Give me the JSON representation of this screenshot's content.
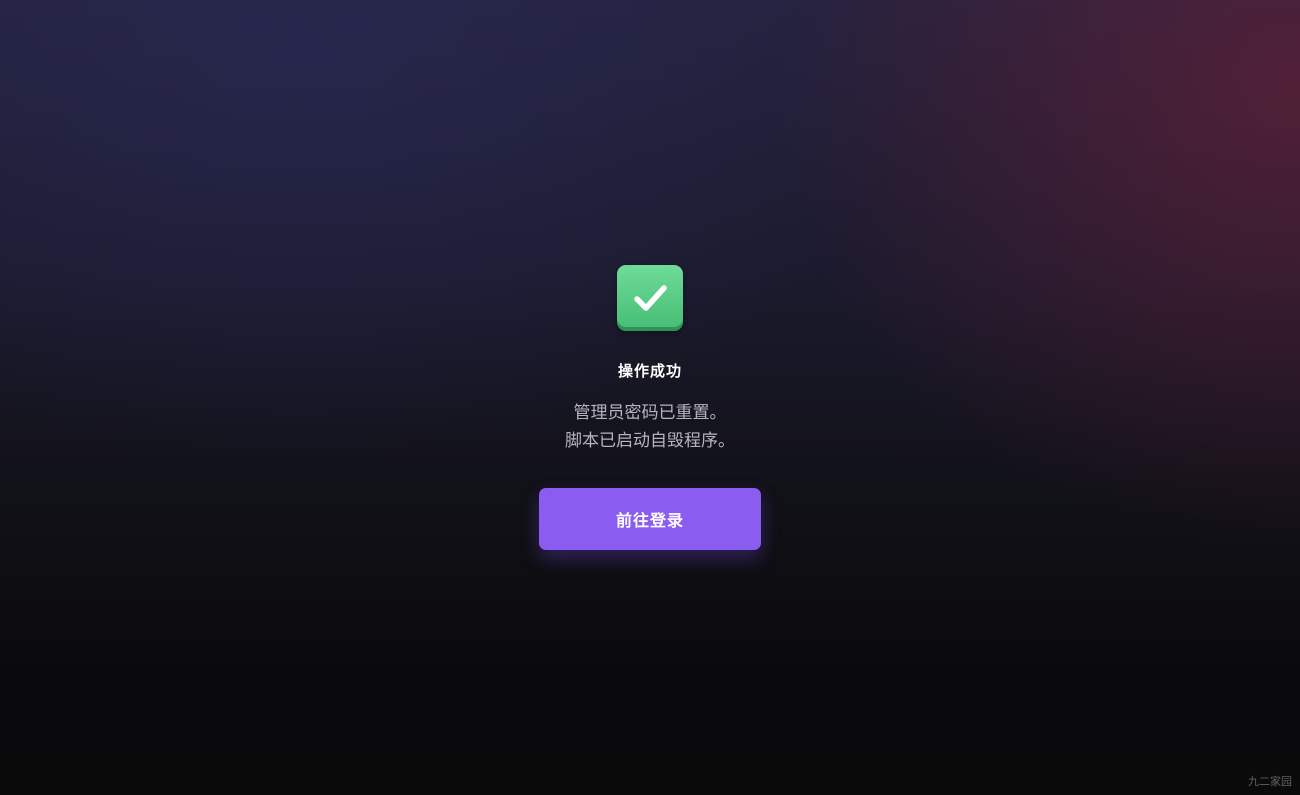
{
  "success": {
    "icon": "check-mark-icon",
    "icon_color": "#4fc97e",
    "title": "操作成功",
    "message_line1": "管理员密码已重置。",
    "message_line2": "脚本已启动自毁程序。"
  },
  "login_button": {
    "label": "前往登录",
    "color": "#8b5cf0"
  },
  "watermark": {
    "text": "九二家园"
  }
}
